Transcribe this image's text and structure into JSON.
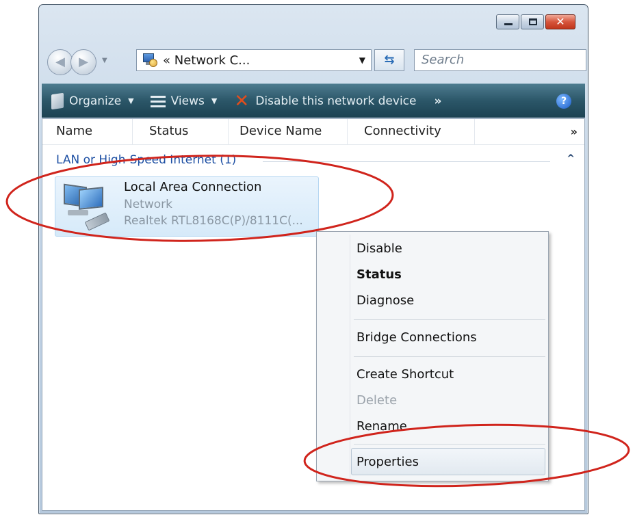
{
  "address_bar": {
    "path": "« Network C...",
    "search_placeholder": "Search"
  },
  "toolbar": {
    "organize_label": "Organize",
    "views_label": "Views",
    "disable_label": "Disable this network device",
    "more_label": "»",
    "help_label": "?"
  },
  "columns": {
    "name": "Name",
    "status": "Status",
    "device_name": "Device Name",
    "connectivity": "Connectivity",
    "more": "»"
  },
  "group": {
    "title": "LAN or High-Speed Internet (1)",
    "collapse": "^"
  },
  "connection": {
    "name": "Local Area Connection",
    "type": "Network",
    "device": "Realtek RTL8168C(P)/8111C(..."
  },
  "context_menu": {
    "disable": "Disable",
    "status": "Status",
    "diagnose": "Diagnose",
    "bridge": "Bridge Connections",
    "shortcut": "Create Shortcut",
    "delete": "Delete",
    "rename": "Rename",
    "properties": "Properties"
  },
  "window_buttons": {
    "close_glyph": "✕"
  },
  "colors": {
    "toolbar_bg": "#2b5668",
    "group_header": "#1d4fa3",
    "annotation": "#d0241c"
  },
  "icons": [
    "back-arrow-icon",
    "forward-arrow-icon",
    "network-folder-icon",
    "refresh-icon",
    "organize-icon",
    "views-icon",
    "disable-x-icon",
    "help-icon",
    "network-connection-icon"
  ]
}
